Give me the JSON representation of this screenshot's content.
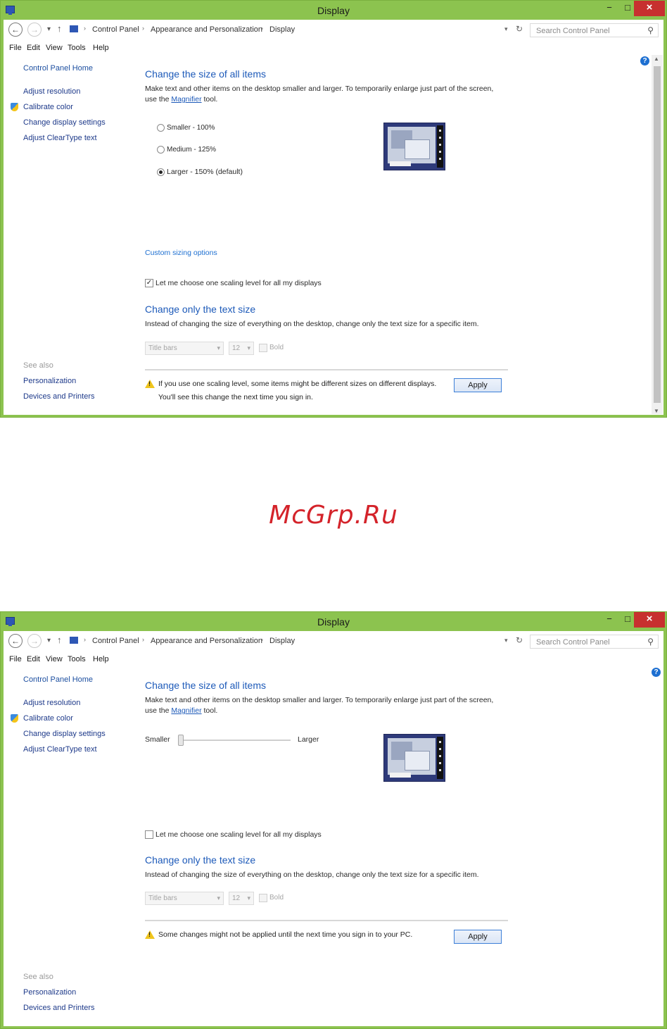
{
  "colors": {
    "titlebar": "#8cc34f",
    "link": "#1d5ab9",
    "close": "#c7302f",
    "watermark": "#d4232a"
  },
  "watermark": "McGrp.Ru",
  "window": {
    "title": "Display",
    "min_glyph": "−",
    "max_glyph": "□",
    "close_glyph": "×",
    "breadcrumb": [
      "Control Panel",
      "Appearance and Personalization",
      "Display"
    ],
    "search_placeholder": "Search Control Panel",
    "menu": [
      "File",
      "Edit",
      "View",
      "Tools",
      "Help"
    ],
    "help_glyph": "?",
    "sidebar": {
      "home": "Control Panel Home",
      "items": [
        "Adjust resolution",
        "Calibrate color",
        "Change display settings",
        "Adjust ClearType text"
      ],
      "see_also_label": "See also",
      "see_also": [
        "Personalization",
        "Devices and Printers"
      ]
    },
    "heading_all": "Change the size of all items",
    "desc_all_1": "Make text and other items on the desktop smaller and larger. To temporarily enlarge just part of the screen,",
    "desc_all_2a": "use the ",
    "magnifier": "Magnifier",
    "desc_all_2b": " tool.",
    "heading_text": "Change only the text size",
    "desc_text": "Instead of changing the size of everything on the desktop, change only the text size for a specific item.",
    "text_item": "Title bars",
    "font_size": "12",
    "bold": "Bold",
    "apply": "Apply",
    "scaling_checkbox": "Let me choose one scaling level for all my displays"
  },
  "top_panel": {
    "options": [
      {
        "label": "Smaller - 100%",
        "selected": false
      },
      {
        "label": "Medium - 125%",
        "selected": false
      },
      {
        "label": "Larger - 150% (default)",
        "selected": true
      }
    ],
    "custom_link": "Custom sizing options",
    "scaling_checked": true,
    "warning_1": "If you use one scaling level, some items might be different sizes on different displays.",
    "warning_2": "You'll see this change the next time you sign in."
  },
  "bottom_panel": {
    "slider_min_label": "Smaller",
    "slider_max_label": "Larger",
    "slider_value": 0,
    "scaling_checked": false,
    "warning": "Some changes might not be applied until the next time you sign in to your PC."
  }
}
